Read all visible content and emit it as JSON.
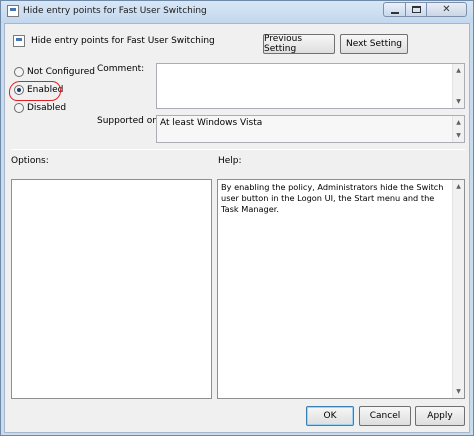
{
  "window": {
    "title": "Hide entry points for Fast User Switching",
    "buttons": {
      "minimize": "minimize",
      "maximize": "maximize",
      "close": "✕"
    }
  },
  "header": {
    "policy_name": "Hide entry points for Fast User Switching"
  },
  "nav": {
    "previous": "Previous Setting",
    "next": "Next Setting"
  },
  "state": {
    "options": [
      {
        "label": "Not Configured",
        "checked": false
      },
      {
        "label": "Enabled",
        "checked": true
      },
      {
        "label": "Disabled",
        "checked": false
      }
    ]
  },
  "comment": {
    "label": "Comment:",
    "value": ""
  },
  "supported": {
    "label": "Supported on:",
    "value": "At least Windows Vista"
  },
  "options_panel": {
    "label": "Options:"
  },
  "help_panel": {
    "label": "Help:",
    "text": "By enabling the policy, Administrators hide the Switch user button in the Logon UI, the Start menu and the Task Manager."
  },
  "footer": {
    "ok": "OK",
    "cancel": "Cancel",
    "apply": "Apply"
  },
  "colors": {
    "annotation_ring": "#e02020"
  },
  "icons": {
    "title": "policy-setting-icon",
    "scroll_up": "scroll-up-icon",
    "scroll_down": "scroll-down-icon"
  }
}
